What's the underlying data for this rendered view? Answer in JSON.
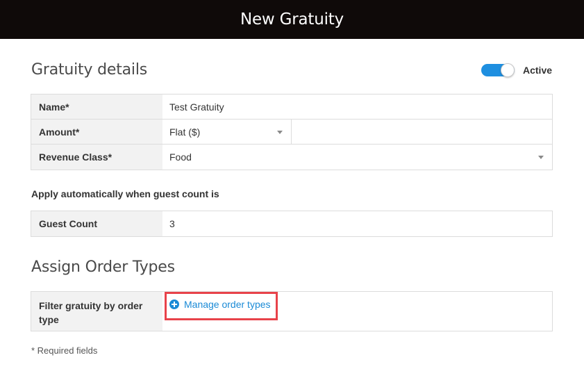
{
  "header": {
    "title": "New Gratuity"
  },
  "gratuity_details": {
    "title": "Gratuity details",
    "active_toggle": {
      "label": "Active",
      "on": true,
      "color": "#1e8fe0"
    },
    "fields": {
      "name": {
        "label": "Name*",
        "value": "Test Gratuity"
      },
      "amount": {
        "label": "Amount*",
        "type_value": "Flat ($)",
        "amount_value": ""
      },
      "revenue_class": {
        "label": "Revenue Class*",
        "value": "Food"
      }
    }
  },
  "auto_apply": {
    "heading": "Apply automatically when guest count is",
    "guest_count": {
      "label": "Guest Count",
      "value": "3"
    }
  },
  "order_types": {
    "title": "Assign Order Types",
    "filter": {
      "label": "Filter gratuity by order type",
      "link": "Manage order types",
      "icon": "plus-circle-icon"
    },
    "highlight_color": "#e8424a"
  },
  "footer": {
    "required_note": "* Required fields"
  }
}
